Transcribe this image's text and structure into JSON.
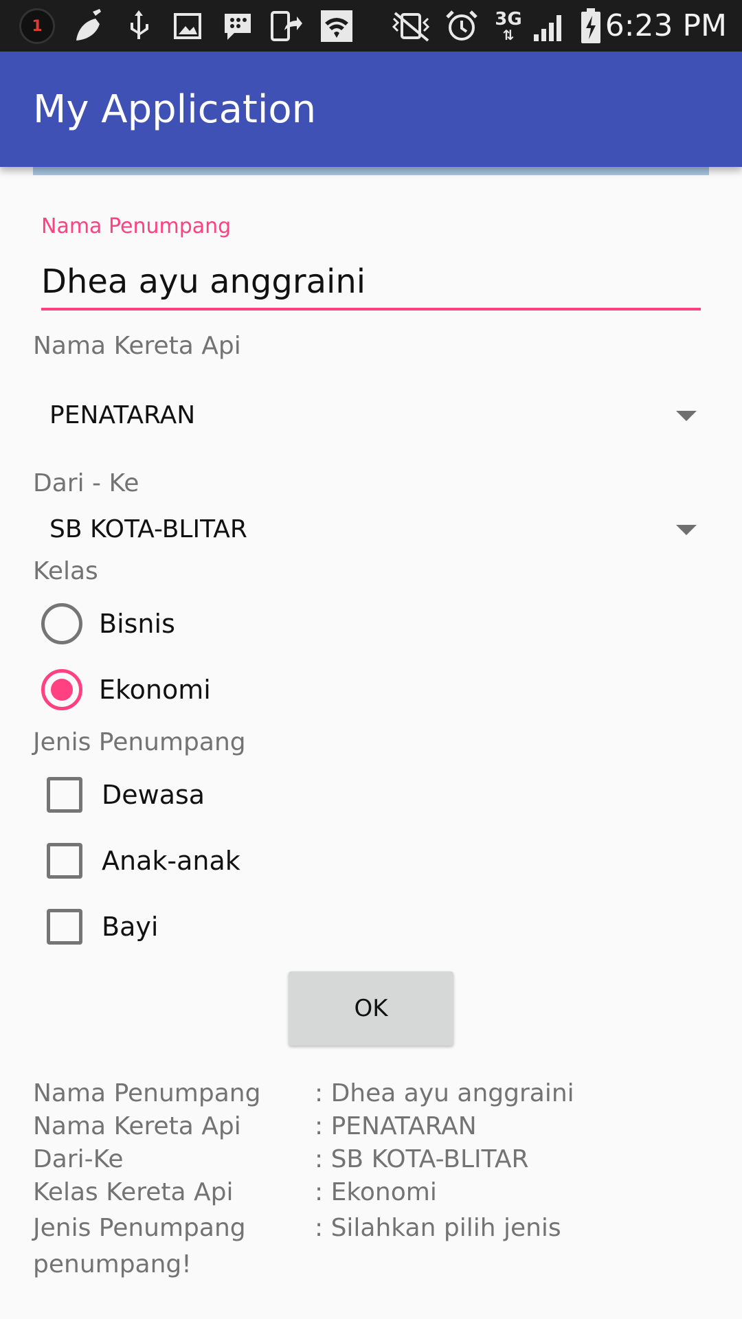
{
  "status_bar": {
    "notification_count": "1",
    "network_type": "3G",
    "time": "6:23 PM",
    "icons": [
      "notification-count-icon",
      "cleaner-brush-icon",
      "usb-icon",
      "image-icon",
      "bbm-icon",
      "screen-share-icon",
      "wifi-icon",
      "vibrate-mute-icon",
      "alarm-icon",
      "signal-icon",
      "battery-charging-icon"
    ]
  },
  "app_bar": {
    "title": "My Application"
  },
  "form": {
    "passenger_name_label": "Nama Penumpang",
    "passenger_name_value": "Dhea ayu anggraini",
    "train_label": "Nama Kereta Api",
    "train_selected": "PENATARAN",
    "route_label": "Dari - Ke",
    "route_selected": "SB KOTA-BLITAR",
    "class_label": "Kelas",
    "class_options": [
      {
        "label": "Bisnis",
        "checked": false
      },
      {
        "label": "Ekonomi",
        "checked": true
      }
    ],
    "passenger_type_label": "Jenis Penumpang",
    "passenger_type_options": [
      {
        "label": "Dewasa",
        "checked": false
      },
      {
        "label": "Anak-anak",
        "checked": false
      },
      {
        "label": "Bayi",
        "checked": false
      }
    ],
    "ok_button": "OK"
  },
  "summary": {
    "rows": [
      {
        "key": "Nama Penumpang",
        "value": ": Dhea ayu anggraini"
      },
      {
        "key": "Nama Kereta Api",
        "value": ": PENATARAN"
      },
      {
        "key": "Dari-Ke",
        "value": ": SB KOTA-BLITAR"
      },
      {
        "key": "Kelas Kereta Api",
        "value": ": Ekonomi"
      },
      {
        "key": "Jenis Penumpang",
        "value": ": Silahkan pilih jenis"
      }
    ],
    "wrap_line": "penumpang!"
  },
  "colors": {
    "status_bar": "#1c1c1c",
    "app_bar": "#3f51b5",
    "accent": "#ff4081",
    "background": "#fafafa",
    "button": "#d6d7d7"
  }
}
